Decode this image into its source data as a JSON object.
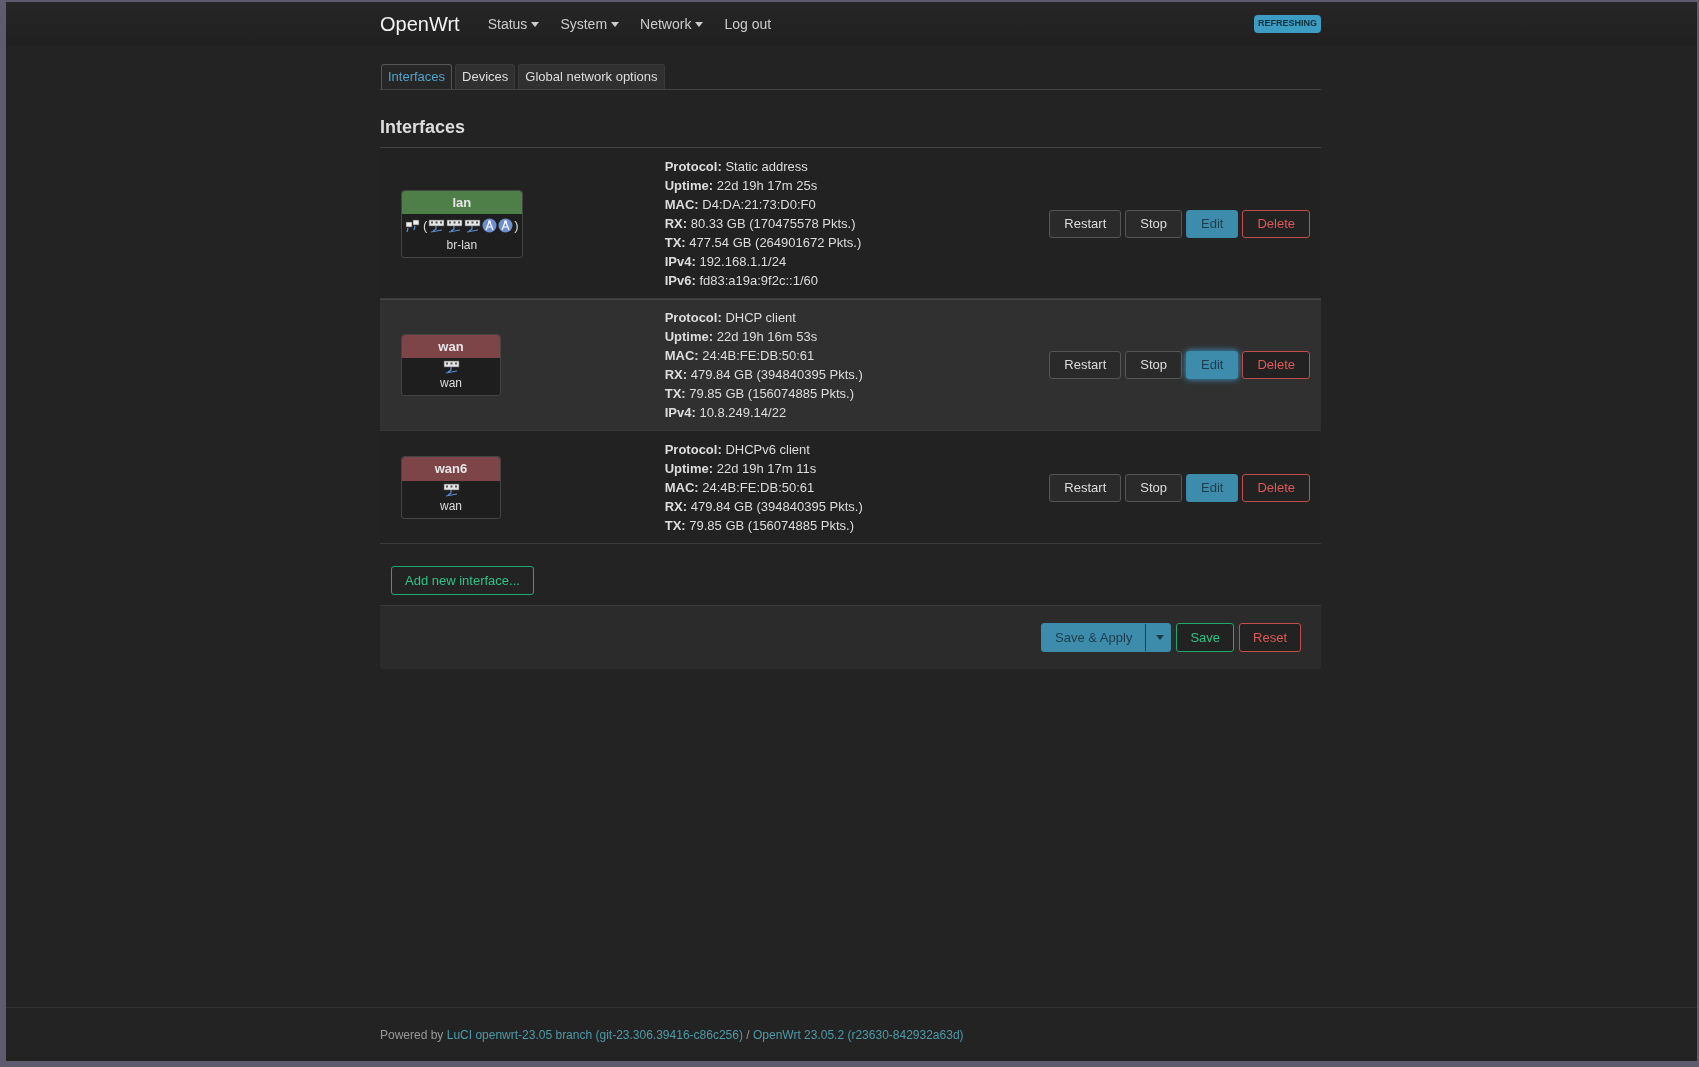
{
  "brand": "OpenWrt",
  "nav": [
    {
      "label": "Status",
      "dropdown": true
    },
    {
      "label": "System",
      "dropdown": true
    },
    {
      "label": "Network",
      "dropdown": true
    },
    {
      "label": "Log out",
      "dropdown": false
    }
  ],
  "status_badge": "REFRESHING",
  "tabs": [
    {
      "label": "Interfaces",
      "selected": true
    },
    {
      "label": "Devices",
      "selected": false
    },
    {
      "label": "Global network options",
      "selected": false
    }
  ],
  "heading": "Interfaces",
  "interfaces": [
    {
      "name": "lan",
      "color": "#4f7f48",
      "hovered": false,
      "device": "br-lan",
      "ports": {
        "open": "(",
        "close": ")",
        "lead": [
          {
            "kind": "bridge"
          }
        ],
        "members": [
          {
            "kind": "ethernet"
          },
          {
            "kind": "ethernet"
          },
          {
            "kind": "ethernet"
          },
          {
            "kind": "wifi"
          },
          {
            "kind": "wifi"
          }
        ]
      },
      "info": [
        {
          "label": "Protocol:",
          "value": "Static address"
        },
        {
          "label": "Uptime:",
          "value": "22d 19h 17m 25s"
        },
        {
          "label": "MAC:",
          "value": "D4:DA:21:73:D0:F0"
        },
        {
          "label": "RX:",
          "value": "80.33 GB (170475578 Pkts.)"
        },
        {
          "label": "TX:",
          "value": "477.54 GB (264901672 Pkts.)"
        },
        {
          "label": "IPv4:",
          "value": "192.168.1.1/24"
        },
        {
          "label": "IPv6:",
          "value": "fd83:a19a:9f2c::1/60"
        }
      ],
      "buttons": [
        {
          "label": "Restart",
          "kind": "default",
          "focused": false
        },
        {
          "label": "Stop",
          "kind": "default",
          "focused": false
        },
        {
          "label": "Edit",
          "kind": "primary",
          "focused": false
        },
        {
          "label": "Delete",
          "kind": "danger",
          "focused": false
        }
      ]
    },
    {
      "name": "wan",
      "color": "#7d4548",
      "hovered": true,
      "device": "wan",
      "ports": {
        "lead": [
          {
            "kind": "ethernet"
          }
        ]
      },
      "info": [
        {
          "label": "Protocol:",
          "value": "DHCP client"
        },
        {
          "label": "Uptime:",
          "value": "22d 19h 16m 53s"
        },
        {
          "label": "MAC:",
          "value": "24:4B:FE:DB:50:61"
        },
        {
          "label": "RX:",
          "value": "479.84 GB (394840395 Pkts.)"
        },
        {
          "label": "TX:",
          "value": "79.85 GB (156074885 Pkts.)"
        },
        {
          "label": "IPv4:",
          "value": "10.8.249.14/22"
        }
      ],
      "buttons": [
        {
          "label": "Restart",
          "kind": "default",
          "focused": false
        },
        {
          "label": "Stop",
          "kind": "default",
          "focused": false
        },
        {
          "label": "Edit",
          "kind": "primary",
          "focused": true
        },
        {
          "label": "Delete",
          "kind": "danger",
          "focused": false
        }
      ]
    },
    {
      "name": "wan6",
      "color": "#7d4548",
      "hovered": false,
      "device": "wan",
      "ports": {
        "lead": [
          {
            "kind": "ethernet"
          }
        ]
      },
      "info": [
        {
          "label": "Protocol:",
          "value": "DHCPv6 client"
        },
        {
          "label": "Uptime:",
          "value": "22d 19h 17m 11s"
        },
        {
          "label": "MAC:",
          "value": "24:4B:FE:DB:50:61"
        },
        {
          "label": "RX:",
          "value": "479.84 GB (394840395 Pkts.)"
        },
        {
          "label": "TX:",
          "value": "79.85 GB (156074885 Pkts.)"
        }
      ],
      "buttons": [
        {
          "label": "Restart",
          "kind": "default",
          "focused": false
        },
        {
          "label": "Stop",
          "kind": "default",
          "focused": false
        },
        {
          "label": "Edit",
          "kind": "primary",
          "focused": false
        },
        {
          "label": "Delete",
          "kind": "danger",
          "focused": false
        }
      ]
    }
  ],
  "add_button": "Add new interface...",
  "actions": [
    {
      "label": "Save & Apply",
      "kind": "primary",
      "dropdown": true
    },
    {
      "label": "Save",
      "kind": "positive",
      "dropdown": false
    },
    {
      "label": "Reset",
      "kind": "danger",
      "dropdown": false
    }
  ],
  "footer": {
    "prefix": "Powered by",
    "links": [
      {
        "label": "LuCI openwrt-23.05 branch (git-23.306.39416-c86c256)"
      },
      {
        "label": "OpenWrt 23.05.2 (r23630-842932a63d)"
      }
    ],
    "separator": "/"
  }
}
